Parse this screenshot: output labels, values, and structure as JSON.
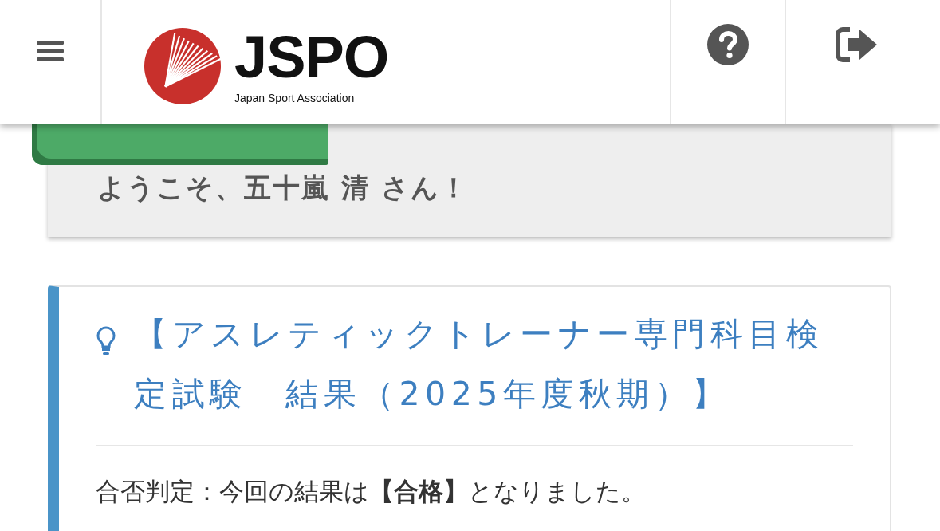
{
  "header": {
    "logo": {
      "wordmark": "JSPO",
      "tagline": "Japan Sport Association"
    }
  },
  "welcome": {
    "message": "ようこそ、五十嵐 清 さん！"
  },
  "notice": {
    "title": "【アスレティックトレーナー専門科目検定試験　結果（2025年度秋期）】",
    "body": "合否判定：今回の結果は**【合格】**となりました。"
  }
}
